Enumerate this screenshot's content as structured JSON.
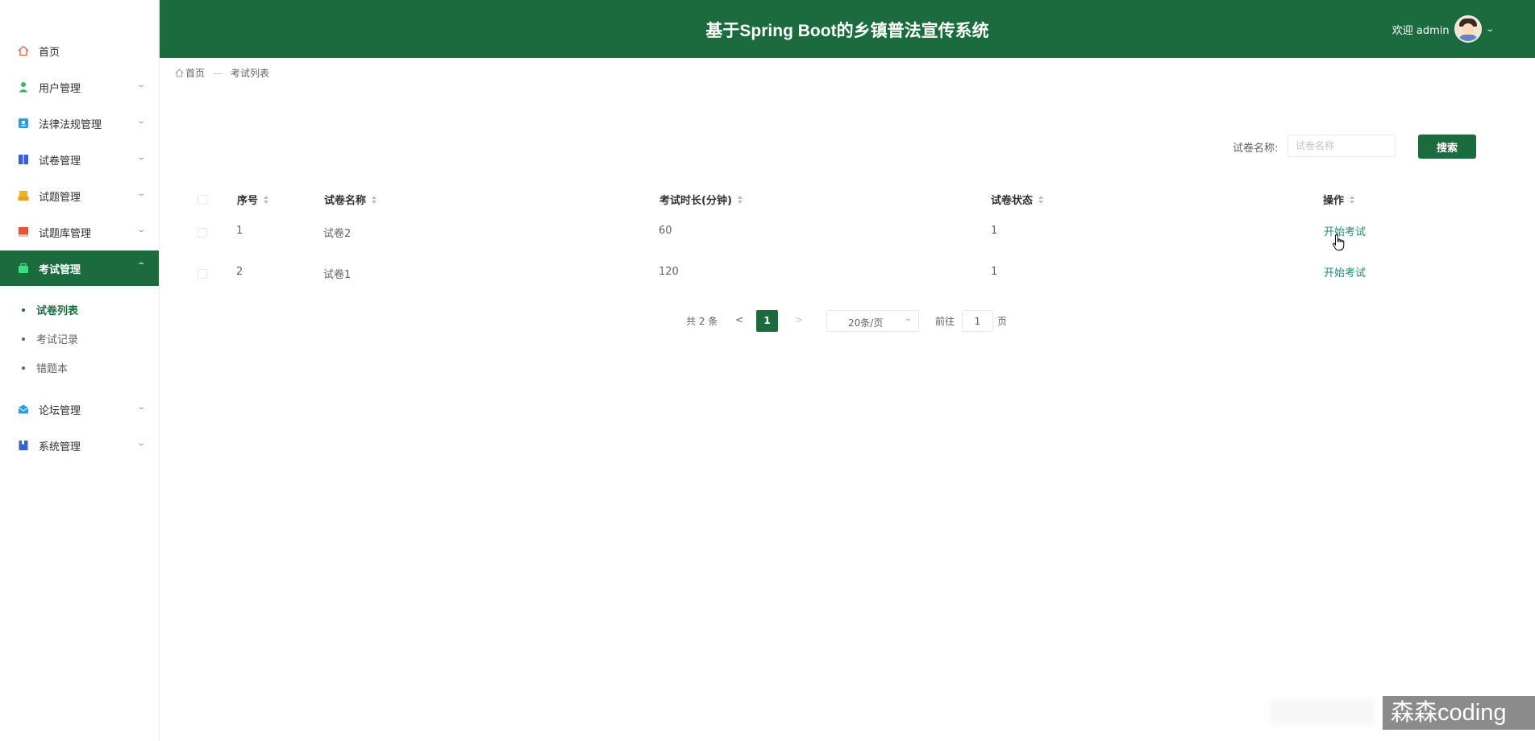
{
  "header": {
    "title": "基于Spring Boot的乡镇普法宣传系统",
    "welcome": "欢迎 admin"
  },
  "sidebar": {
    "items": [
      {
        "label": "首页",
        "icon": "home-icon",
        "color": "#e15b4b",
        "arrow": ""
      },
      {
        "label": "用户管理",
        "icon": "user-icon",
        "color": "#2fb865",
        "arrow": "⌄"
      },
      {
        "label": "法律法规管理",
        "icon": "law-book-icon",
        "color": "#2a9fe0",
        "arrow": "⌄"
      },
      {
        "label": "试卷管理",
        "icon": "paper-icon",
        "color": "#3a60d6",
        "arrow": "⌄"
      },
      {
        "label": "试题管理",
        "icon": "question-icon",
        "color": "#f0b323",
        "arrow": "⌄"
      },
      {
        "label": "试题库管理",
        "icon": "question-bank-icon",
        "color": "#e0573f",
        "arrow": "⌄"
      },
      {
        "label": "考试管理",
        "icon": "exam-icon",
        "color": "#ffffff",
        "arrow": "⌃",
        "active": true
      },
      {
        "label": "论坛管理",
        "icon": "forum-icon",
        "color": "#2a9fe0",
        "arrow": "⌄"
      },
      {
        "label": "系统管理",
        "icon": "system-icon",
        "color": "#3a60d6",
        "arrow": "⌄"
      }
    ],
    "sub_items": [
      {
        "label": "试卷列表",
        "active": true
      },
      {
        "label": "考试记录"
      },
      {
        "label": "错题本"
      }
    ]
  },
  "breadcrumb": {
    "home": "首页",
    "separator": "—",
    "current": "考试列表"
  },
  "search": {
    "label": "试卷名称:",
    "placeholder": "试卷名称",
    "button": "搜索"
  },
  "table": {
    "columns": [
      "序号",
      "试卷名称",
      "考试时长(分钟)",
      "试卷状态",
      "操作"
    ],
    "rows": [
      {
        "index": "1",
        "name": "试卷2",
        "duration": "60",
        "status": "1",
        "action": "开始考试"
      },
      {
        "index": "2",
        "name": "试卷1",
        "duration": "120",
        "status": "1",
        "action": "开始考试"
      }
    ]
  },
  "pagination": {
    "total": "共 2 条",
    "prev": "<",
    "current": "1",
    "next": ">",
    "page_size": "20条/页",
    "goto_label": "前往",
    "goto_value": "1",
    "page_label": "页"
  },
  "watermark": "森森coding",
  "colors": {
    "primary": "#1c6b3e",
    "link": "#1c8d72"
  }
}
